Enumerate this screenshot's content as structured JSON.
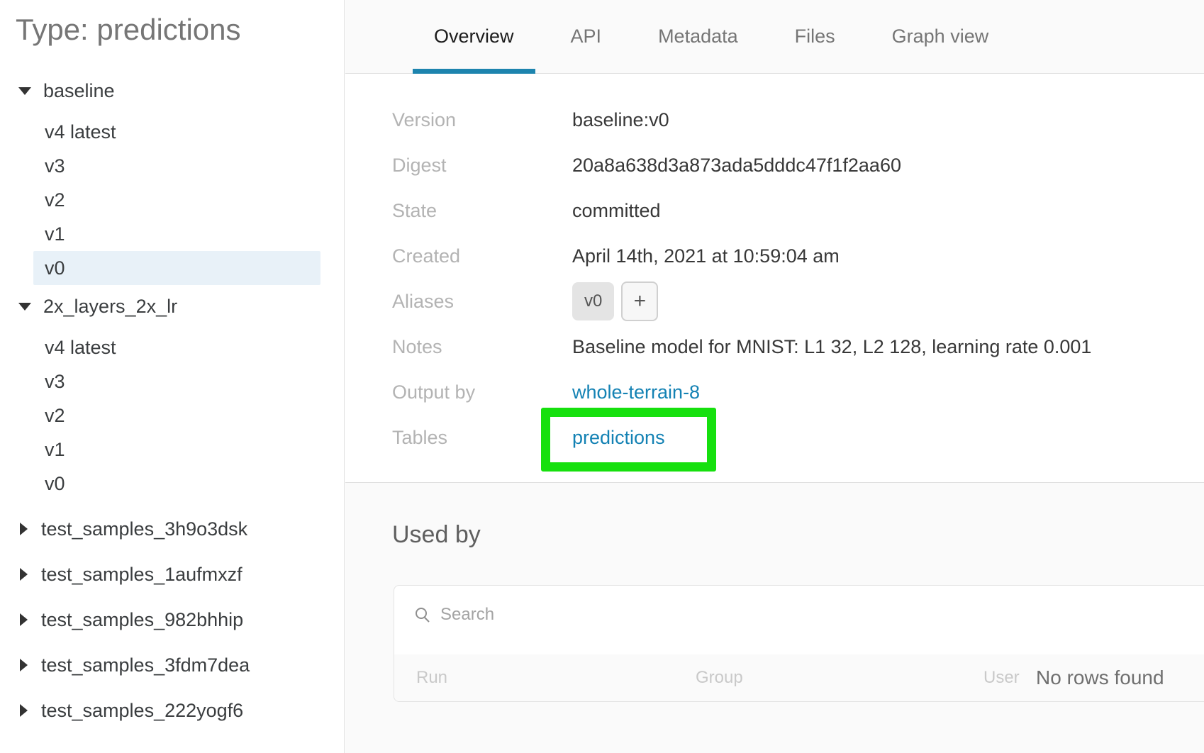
{
  "sidebar": {
    "title": "Type: predictions",
    "groups": [
      {
        "label": "baseline",
        "expanded": true,
        "versions": [
          "v4 latest",
          "v3",
          "v2",
          "v1",
          "v0"
        ]
      },
      {
        "label": "2x_layers_2x_lr",
        "expanded": true,
        "versions": [
          "v4 latest",
          "v3",
          "v2",
          "v1",
          "v0"
        ]
      },
      {
        "label": "test_samples_3h9o3dsk",
        "expanded": false
      },
      {
        "label": "test_samples_1aufmxzf",
        "expanded": false
      },
      {
        "label": "test_samples_982bhhip",
        "expanded": false
      },
      {
        "label": "test_samples_3fdm7dea",
        "expanded": false
      },
      {
        "label": "test_samples_222yogf6",
        "expanded": false
      }
    ],
    "selected_version": "baseline / v0"
  },
  "tabs": {
    "items": [
      "Overview",
      "API",
      "Metadata",
      "Files",
      "Graph view"
    ],
    "active": "Overview"
  },
  "overview": {
    "version_label": "Version",
    "version_value": "baseline:v0",
    "digest_label": "Digest",
    "digest_value": "20a8a638d3a873ada5dddc47f1f2aa60",
    "state_label": "State",
    "state_value": "committed",
    "created_label": "Created",
    "created_value": "April 14th, 2021 at 10:59:04 am",
    "aliases_label": "Aliases",
    "alias_chip": "v0",
    "alias_add": "+",
    "notes_label": "Notes",
    "notes_value": "Baseline model for MNIST: L1 32, L2 128, learning rate 0.001",
    "output_by_label": "Output by",
    "output_by_value": "whole-terrain-8",
    "tables_label": "Tables",
    "tables_value": "predictions"
  },
  "used_by": {
    "heading": "Used by",
    "search_placeholder": "Search",
    "col_run": "Run",
    "col_group": "Group",
    "col_user": "User",
    "empty": "No rows found"
  },
  "icons": {
    "search": "magnifier",
    "expanded_group": "chevron-down",
    "collapsed_group": "chevron-right"
  },
  "colors": {
    "accent_blue": "#1d84ae",
    "link_blue": "#1482b4",
    "highlight_green": "#16e00e",
    "selected_version_bg": "#e8f1f8"
  }
}
